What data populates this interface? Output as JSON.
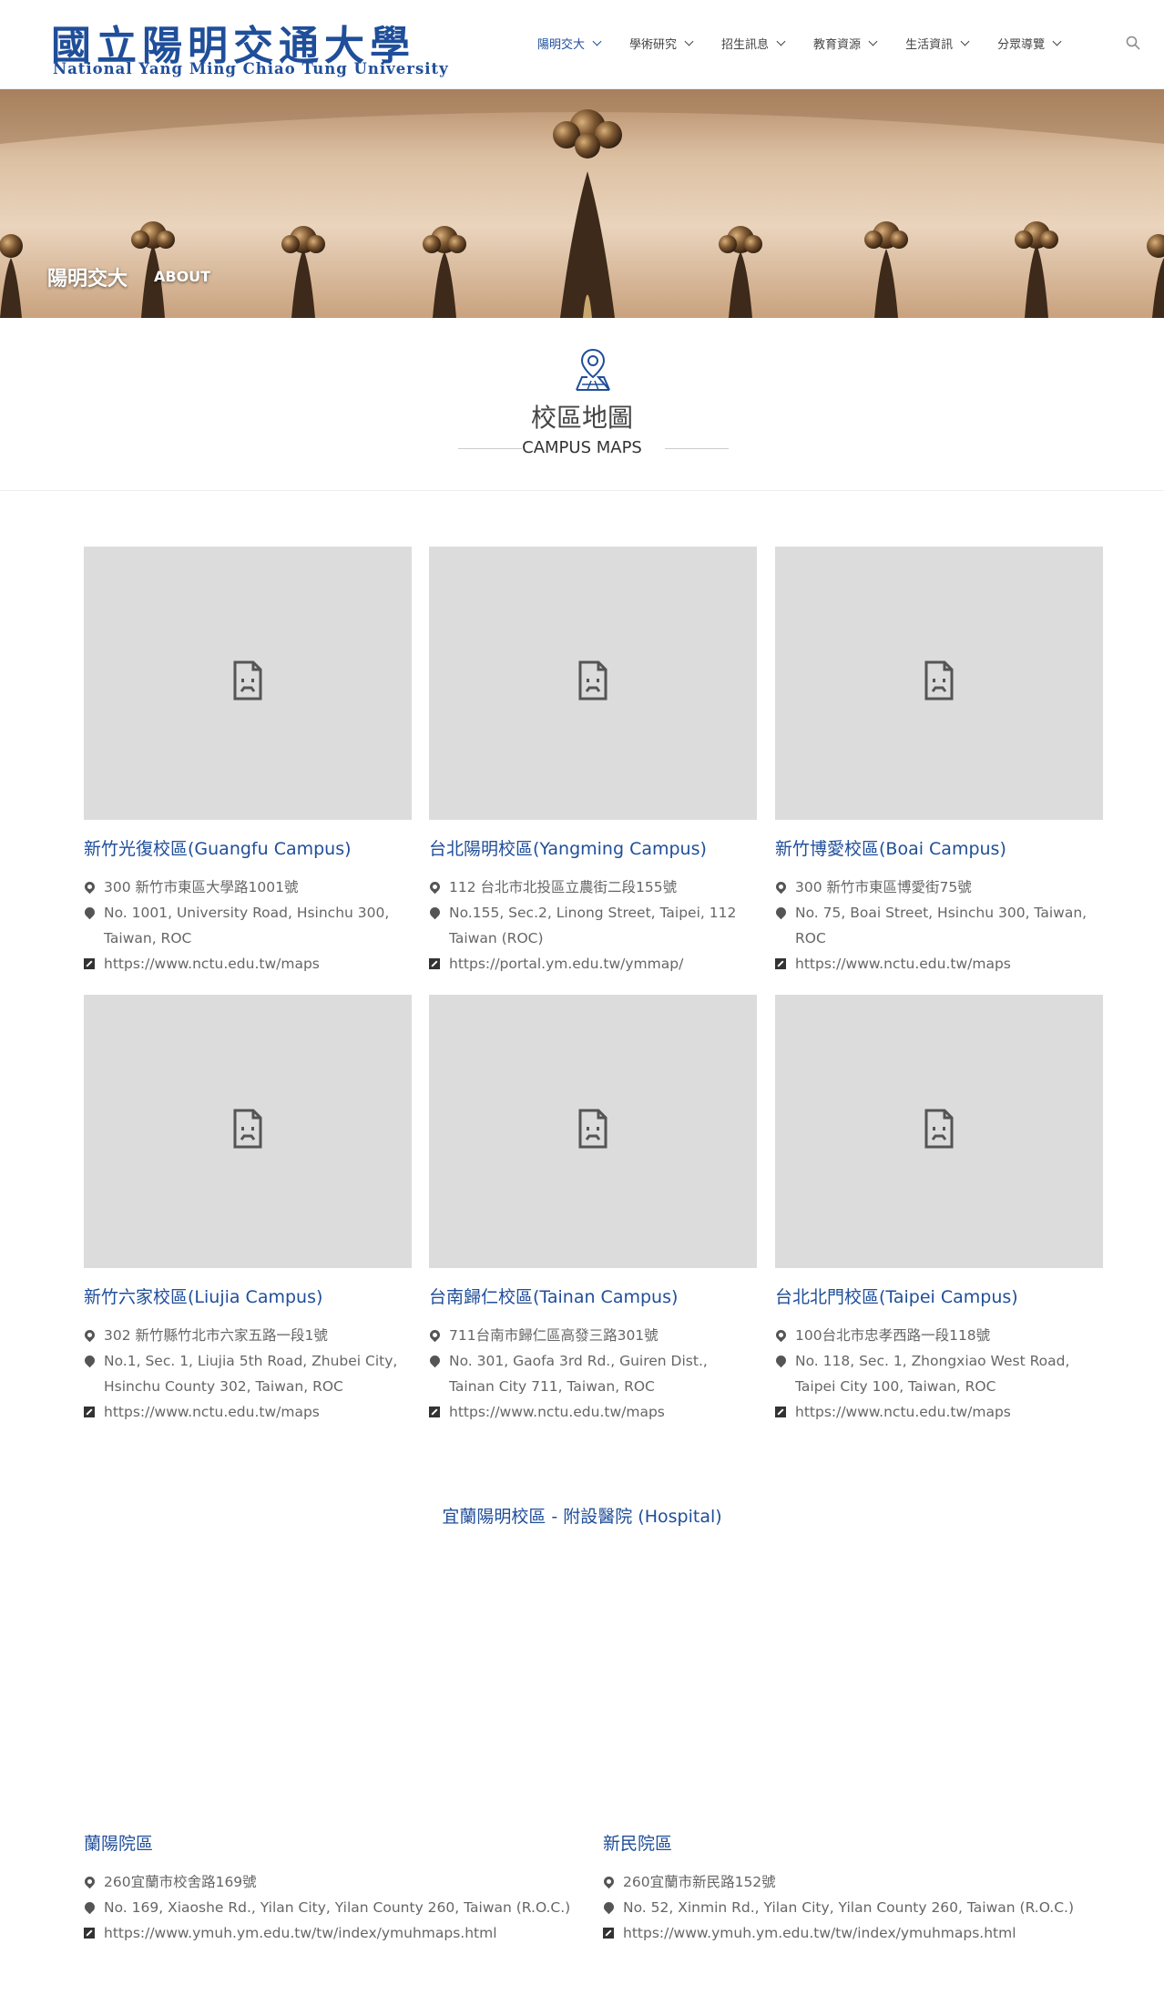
{
  "header": {
    "logo_zh": "國立陽明交通大學",
    "logo_en": "National Yang Ming Chiao Tung University",
    "nav": [
      {
        "label": "陽明交大",
        "active": true
      },
      {
        "label": "學術研究"
      },
      {
        "label": "招生訊息"
      },
      {
        "label": "教育資源"
      },
      {
        "label": "生活資訊"
      },
      {
        "label": "分眾導覽"
      }
    ]
  },
  "banner": {
    "title": "陽明交大",
    "subtitle": "ABOUT"
  },
  "section": {
    "title_zh": "校區地圖",
    "title_en": "CAMPUS MAPS"
  },
  "campuses": [
    {
      "name": "新竹光復校區(Guangfu Campus)",
      "address_zh": "300 新竹市東區大學路1001號",
      "address_en": "No. 1001, University Road, Hsinchu 300, Taiwan, ROC",
      "url": "https://www.nctu.edu.tw/maps"
    },
    {
      "name": "台北陽明校區(Yangming Campus)",
      "address_zh": "112 台北市北投區立農街二段155號",
      "address_en": "No.155, Sec.2, Linong Street, Taipei, 112 Taiwan (ROC)",
      "url": "https://portal.ym.edu.tw/ymmap/"
    },
    {
      "name": "新竹博愛校區(Boai Campus)",
      "address_zh": "300 新竹市東區博愛街75號",
      "address_en": "No. 75, Boai Street, Hsinchu 300, Taiwan, ROC",
      "url": "https://www.nctu.edu.tw/maps"
    },
    {
      "name": "新竹六家校區(Liujia Campus)",
      "address_zh": "302 新竹縣竹北市六家五路一段1號",
      "address_en": "No.1, Sec. 1, Liujia 5th Road, Zhubei City, Hsinchu County 302, Taiwan, ROC",
      "url": "https://www.nctu.edu.tw/maps"
    },
    {
      "name": "台南歸仁校區(Tainan Campus)",
      "address_zh": "711台南市歸仁區高發三路301號",
      "address_en": "No. 301, Gaofa 3rd Rd., Guiren Dist., Tainan City 711, Taiwan, ROC",
      "url": "https://www.nctu.edu.tw/maps"
    },
    {
      "name": "台北北門校區(Taipei Campus)",
      "address_zh": "100台北市忠孝西路一段118號",
      "address_en": "No. 118, Sec. 1, Zhongxiao West Road, Taipei City 100, Taiwan, ROC",
      "url": "https://www.nctu.edu.tw/maps"
    }
  ],
  "hospital": {
    "title": "宜蘭陽明校區 - 附設醫院 (Hospital)",
    "branches": [
      {
        "name": "蘭陽院區",
        "address_zh": "260宜蘭市校舍路169號",
        "address_en": "No. 169, Xiaoshe Rd., Yilan City, Yilan County 260, Taiwan (R.O.C.)",
        "url": "https://www.ymuh.ym.edu.tw/tw/index/ymuhmaps.html"
      },
      {
        "name": "新民院區",
        "address_zh": "260宜蘭市新民路152號",
        "address_en": "No. 52, Xinmin Rd., Yilan City, Yilan County 260, Taiwan (R.O.C.)",
        "url": "https://www.ymuh.ym.edu.tw/tw/index/ymuhmaps.html"
      }
    ]
  },
  "colors": {
    "brand": "#1f4e9a",
    "map_placeholder": "#dcdcdc"
  },
  "icons": [
    "search-icon",
    "map-pin-icon",
    "location-icon",
    "external-link-icon",
    "broken-image-icon",
    "chevron-down-icon"
  ]
}
